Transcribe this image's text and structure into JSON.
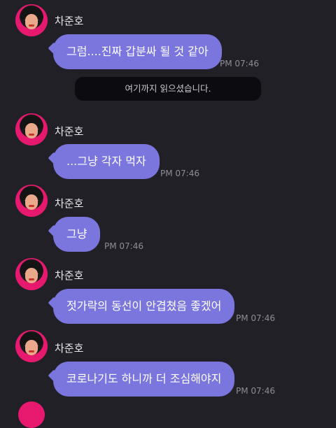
{
  "sender_name": "차준호",
  "read_notice": "여기까지 읽으셨습니다.",
  "messages": [
    {
      "text": "그럼....진짜 갑분싸 될 것 같아",
      "time": "PM 07:46"
    },
    {
      "text": "...그냥 각자 먹자",
      "time": "PM 07:46"
    },
    {
      "text": "그냥",
      "time": "PM 07:46"
    },
    {
      "text": "젓가락의 동선이 안겹쳤음 좋겠어",
      "time": "PM 07:46"
    },
    {
      "text": "코로나기도 하니까 더 조심해야지",
      "time": "PM 07:46"
    }
  ],
  "colors": {
    "background": "#212027",
    "bubble": "#7b76de",
    "banner": "#0c0b10",
    "avatar_accent": "#e6196e"
  }
}
